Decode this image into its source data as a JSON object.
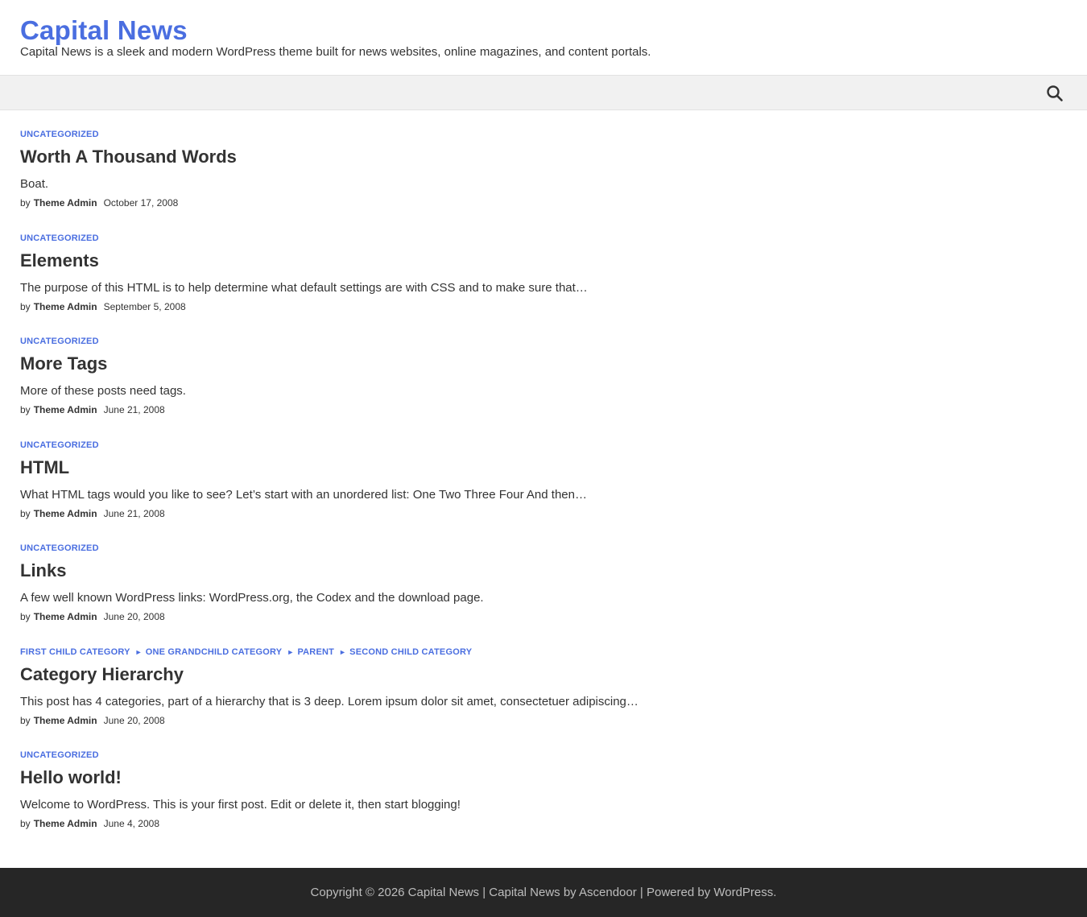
{
  "site": {
    "title": "Capital News",
    "tagline": "Capital News is a sleek and modern WordPress theme built for news websites, online magazines, and content portals."
  },
  "colors": {
    "accent": "#4a6ee0",
    "text": "#333333",
    "nav_bg": "#f1f1f1",
    "footer_bg": "#262626"
  },
  "nav": {
    "search_icon": "search-icon"
  },
  "meta_by": "by",
  "posts": [
    {
      "categories": [
        "Uncategorized"
      ],
      "title": "Worth A Thousand Words",
      "excerpt": "Boat.",
      "author": "Theme Admin",
      "date": "October 17, 2008"
    },
    {
      "categories": [
        "Uncategorized"
      ],
      "title": "Elements",
      "excerpt": "The purpose of this HTML is to help determine what default settings are with CSS and to make sure that…",
      "author": "Theme Admin",
      "date": "September 5, 2008"
    },
    {
      "categories": [
        "Uncategorized"
      ],
      "title": "More Tags",
      "excerpt": "More of these posts need tags.",
      "author": "Theme Admin",
      "date": "June 21, 2008"
    },
    {
      "categories": [
        "Uncategorized"
      ],
      "title": "HTML",
      "excerpt": "What HTML tags would you like to see? Let’s start with an unordered list: One Two Three Four And then…",
      "author": "Theme Admin",
      "date": "June 21, 2008"
    },
    {
      "categories": [
        "Uncategorized"
      ],
      "title": "Links",
      "excerpt": "A few well known WordPress links: WordPress.org, the Codex and the download page.",
      "author": "Theme Admin",
      "date": "June 20, 2008"
    },
    {
      "categories": [
        "First Child Category",
        "One Grandchild Category",
        "Parent",
        "Second Child Category"
      ],
      "title": "Category Hierarchy",
      "excerpt": "This post has 4 categories, part of a hierarchy that is 3 deep. Lorem ipsum dolor sit amet, consectetuer adipiscing…",
      "author": "Theme Admin",
      "date": "June 20, 2008"
    },
    {
      "categories": [
        "Uncategorized"
      ],
      "title": "Hello world!",
      "excerpt": "Welcome to WordPress. This is your first post. Edit or delete it, then start blogging!",
      "author": "Theme Admin",
      "date": "June 4, 2008"
    }
  ],
  "footer": {
    "copyright": "Copyright © 2026 Capital News",
    "separator": "|",
    "theme_credit": "Capital News by Ascendoor",
    "powered_by": "Powered by WordPress."
  }
}
